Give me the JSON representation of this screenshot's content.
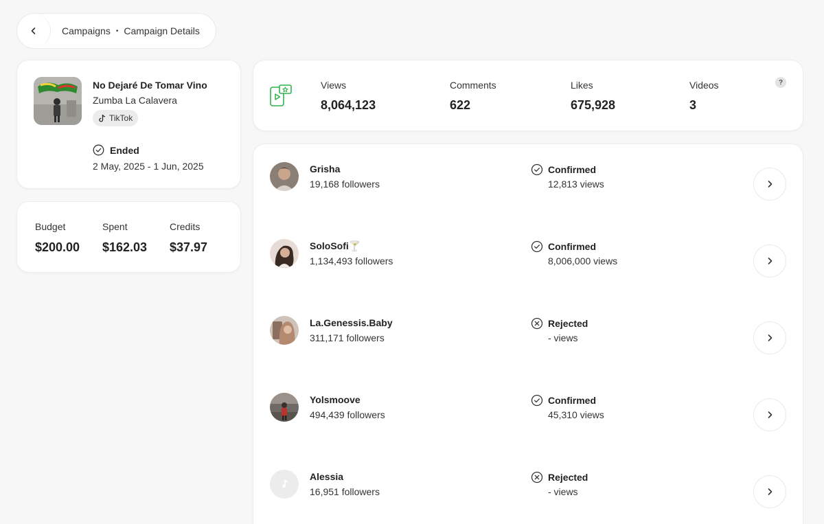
{
  "breadcrumb": {
    "parent": "Campaigns",
    "current": "Campaign Details",
    "separator": "•"
  },
  "campaign": {
    "title": "No Dejaré De Tomar Vino",
    "artist": "Zumba La Calavera",
    "platform": "TikTok",
    "status": "Ended",
    "dates": "2 May, 2025 - 1 Jun, 2025"
  },
  "budget": {
    "budget_label": "Budget",
    "budget_value": "$200.00",
    "spent_label": "Spent",
    "spent_value": "$162.03",
    "credits_label": "Credits",
    "credits_value": "$37.97"
  },
  "stats": {
    "views_label": "Views",
    "views_value": "8,064,123",
    "comments_label": "Comments",
    "comments_value": "622",
    "likes_label": "Likes",
    "likes_value": "675,928",
    "videos_label": "Videos",
    "videos_value": "3",
    "help": "?"
  },
  "creators": [
    {
      "name": "Grisha",
      "followers": "19,168 followers",
      "status": "Confirmed",
      "views": "12,813 views"
    },
    {
      "name": "SoloSofi🍸",
      "followers": "1,134,493 followers",
      "status": "Confirmed",
      "views": "8,006,000 views"
    },
    {
      "name": "La.Genessis.Baby",
      "followers": "311,171 followers",
      "status": "Rejected",
      "views": "- views"
    },
    {
      "name": "Yolsmoove",
      "followers": "494,439 followers",
      "status": "Confirmed",
      "views": "45,310 views"
    },
    {
      "name": "Alessia",
      "followers": "16,951 followers",
      "status": "Rejected",
      "views": "- views"
    }
  ],
  "colors": {
    "accent_green": "#2fb34a",
    "background": "#f7f7f7",
    "card": "#ffffff"
  },
  "icons": {
    "back": "chevron-left-icon",
    "platform": "tiktok-icon",
    "ended": "check-circle-icon",
    "stats": "phone-video-icon",
    "confirmed": "check-circle-icon",
    "rejected": "x-circle-icon",
    "row_action": "chevron-right-icon"
  }
}
